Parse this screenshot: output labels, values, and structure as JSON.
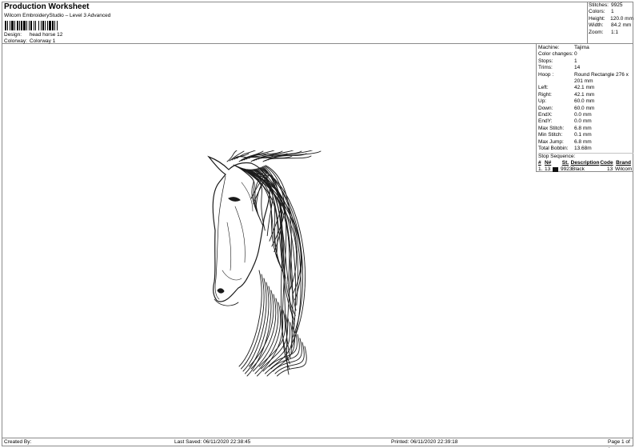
{
  "header": {
    "title": "Production Worksheet",
    "subtitle": "Wilcom EmbroideryStudio – Level 3 Advanced",
    "design_label": "Design:",
    "design_value": "head horse 12",
    "colorway_label": "Colorway:",
    "colorway_value": "Colorway 1"
  },
  "stats": [
    {
      "k": "Stitches:",
      "v": "9925"
    },
    {
      "k": "Colors:",
      "v": "1"
    },
    {
      "k": "Height:",
      "v": "120.0 mm"
    },
    {
      "k": "Width:",
      "v": "84.2 mm"
    },
    {
      "k": "Zoom:",
      "v": "1:1"
    }
  ],
  "machine_info": [
    {
      "k": "Machine:",
      "v": "Tajima"
    },
    {
      "k": "Color changes:",
      "v": "0"
    },
    {
      "k": "Stops:",
      "v": "1"
    },
    {
      "k": "Trims:",
      "v": "14"
    },
    {
      "k": "Hoop :",
      "v": "Round Rectangle 276 x 201 mm"
    },
    {
      "k": "Left:",
      "v": "42.1 mm"
    },
    {
      "k": "Right:",
      "v": "42.1 mm"
    },
    {
      "k": "Up:",
      "v": "60.0 mm"
    },
    {
      "k": "Down:",
      "v": "60.0 mm"
    },
    {
      "k": "EndX:",
      "v": "0.0 mm"
    },
    {
      "k": "EndY:",
      "v": "0.0 mm"
    },
    {
      "k": "Max Stitch:",
      "v": "6.8 mm"
    },
    {
      "k": "Min Stitch:",
      "v": "0.1 mm"
    },
    {
      "k": "Max Jump:",
      "v": "6.8 mm"
    },
    {
      "k": "Total Bobbin:",
      "v": "13.68m"
    }
  ],
  "stop_sequence": {
    "title": "Stop Sequence:",
    "headers": [
      "#",
      "N#",
      "St.",
      "Description",
      "Code",
      "Brand"
    ],
    "rows": [
      {
        "idx": "1.",
        "n": "13",
        "st": "9923",
        "desc": "Black",
        "code": "13",
        "brand": "Wilcom",
        "color": "#111111"
      }
    ]
  },
  "footer": {
    "created": "Created By:",
    "last_saved": "Last Saved: 06/11/2020 22:38:45",
    "printed": "Printed: 06/11/2020 22:39:18",
    "page": "Page 1 of 1"
  }
}
